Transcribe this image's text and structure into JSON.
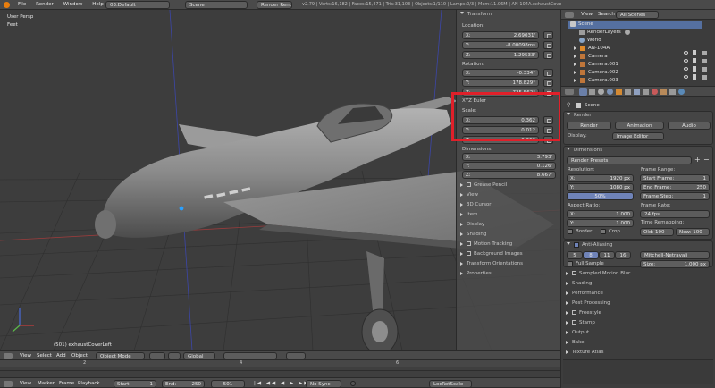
{
  "top_bar": {
    "menus": [
      "File",
      "Render",
      "Window",
      "Help"
    ],
    "layout": "03.Default",
    "scene": "Scene",
    "engine": "Render Render",
    "stats": "v2.79 | Verts:16,182 | Faces:15,471 | Tris:31,103 | Objects:1/110 | Lamps:0/3 | Mem:11.06M | AN-104A.exhaustCoverLeft"
  },
  "viewport": {
    "view_name": "User Persp",
    "units": "Feet",
    "object_label": "(501) exhaustCoverLeft",
    "header": {
      "menus": [
        "View",
        "Select",
        "Add",
        "Object"
      ],
      "mode": "Object Mode",
      "pivot": "Global"
    }
  },
  "n_panel": {
    "transform_title": "Transform",
    "location_label": "Location:",
    "location": [
      {
        "axis": "X:",
        "value": "2.69031'"
      },
      {
        "axis": "Y:",
        "value": "-8.00098ms"
      },
      {
        "axis": "Z:",
        "value": "-1.29533'"
      }
    ],
    "rotation_label": "Rotation:",
    "rotation": [
      {
        "axis": "X:",
        "value": "-0.334°"
      },
      {
        "axis": "Y:",
        "value": "178.829°"
      },
      {
        "axis": "Z:",
        "value": "-725.562°"
      }
    ],
    "mode_label": "XYZ Euler",
    "scale_label": "Scale:",
    "scale": [
      {
        "axis": "X:",
        "value": "0.362"
      },
      {
        "axis": "Y:",
        "value": "0.012"
      },
      {
        "axis": "Z:",
        "value": "0.362"
      }
    ],
    "dimensions_label": "Dimensions:",
    "dimensions": [
      {
        "axis": "X:",
        "value": "3.793'"
      },
      {
        "axis": "Y:",
        "value": "0.126'"
      },
      {
        "axis": "Z:",
        "value": "8.667'"
      }
    ],
    "collapsed": [
      "Grease Pencil",
      "View",
      "3D Cursor",
      "Item",
      "Display",
      "Shading",
      "Motion Tracking",
      "Background Images",
      "Transform Orientations",
      "Properties"
    ]
  },
  "highlight_color": "#e0202a",
  "outliner": {
    "menus": [
      "View",
      "Search"
    ],
    "filter": "All Scenes",
    "items": [
      "Scene",
      "RenderLayers",
      "World",
      "AN-104A",
      "Camera",
      "Camera.001",
      "Camera.002",
      "Camera.003"
    ]
  },
  "properties": {
    "breadcrumb": "Scene",
    "render_section": "Render",
    "render_buttons": [
      "Render",
      "Animation",
      "Audio"
    ],
    "display_label": "Display:",
    "display_value": "Image Editor",
    "dimensions_section": "Dimensions",
    "render_presets": "Render Presets",
    "resolution_label": "Resolution:",
    "res_x": "1920 px",
    "res_y": "1080 px",
    "res_pct": "50%",
    "frame_range_label": "Frame Range:",
    "start_frame": "Start Frame:",
    "start_frame_val": "1",
    "end_frame": "End Frame:",
    "end_frame_val": "250",
    "frame_step": "Frame Step:",
    "frame_step_val": "1",
    "aspect_label": "Aspect Ratio:",
    "aspect_x": "1.000",
    "aspect_y": "1.000",
    "frame_rate_label": "Frame Rate:",
    "frame_rate": "24 fps",
    "time_remap_label": "Time Remapping:",
    "old": "Old: 100",
    "new": "New: 100",
    "border_label": "Border",
    "crop_label": "Crop",
    "aa_label": "Anti-Aliasing",
    "aa_samples": [
      "5",
      "8",
      "11",
      "16"
    ],
    "aa_filter": "Mitchell-Netravali",
    "full_sample": "Full Sample",
    "size_label": "Size:",
    "size_val": "1.000 px",
    "sections": [
      "Sampled Motion Blur",
      "Shading",
      "Performance",
      "Post Processing",
      "Freestyle",
      "Stamp",
      "Output",
      "Bake",
      "Texture Atlas"
    ]
  },
  "timeline": {
    "ruler": [
      "2",
      "4",
      "6"
    ],
    "menus": [
      "View",
      "Marker",
      "Frame",
      "Playback"
    ],
    "start_label": "Start:",
    "start_val": "1",
    "end_label": "End:",
    "end_val": "250",
    "current": "501",
    "sync": "No Sync",
    "keying": "LocRotScale"
  }
}
